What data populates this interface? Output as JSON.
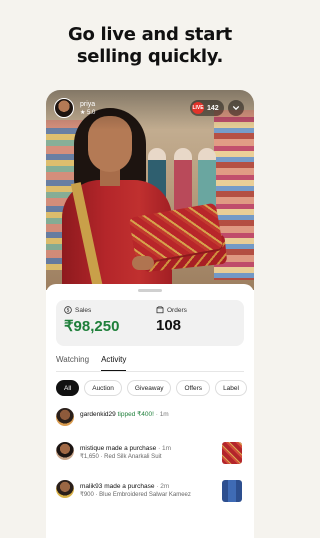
{
  "headline": {
    "line1": "Go live and start",
    "line2": "selling quickly."
  },
  "stream": {
    "host_name": "priya",
    "host_rating": "★ 5.0",
    "live_badge": "LIVE",
    "viewer_count": "142"
  },
  "stats": {
    "sales_label": "Sales",
    "sales_value": "₹98,250",
    "orders_label": "Orders",
    "orders_value": "108"
  },
  "tabs": [
    {
      "label": "Watching",
      "active": false
    },
    {
      "label": "Activity",
      "active": true
    }
  ],
  "filters": [
    {
      "label": "All",
      "active": true
    },
    {
      "label": "Auction",
      "active": false
    },
    {
      "label": "Giveaway",
      "active": false
    },
    {
      "label": "Offers",
      "active": false
    },
    {
      "label": "Label",
      "active": false
    }
  ],
  "feed": [
    {
      "user": "gardenkid29",
      "action": "tipped ₹400!",
      "time": "· 1m",
      "detail": ""
    },
    {
      "user": "mistique",
      "action": "made a purchase",
      "time": "· 1m",
      "detail": "₹1,650 · Red Silk Anarkali Suit"
    },
    {
      "user": "malik93",
      "action": "made a purchase",
      "time": "· 2m",
      "detail": "₹900 · Blue Embroidered Salwar Kameez"
    }
  ],
  "colors": {
    "accent_green": "#1e7f3a",
    "live_red": "#e2332a",
    "background": "#f5f3ee"
  }
}
